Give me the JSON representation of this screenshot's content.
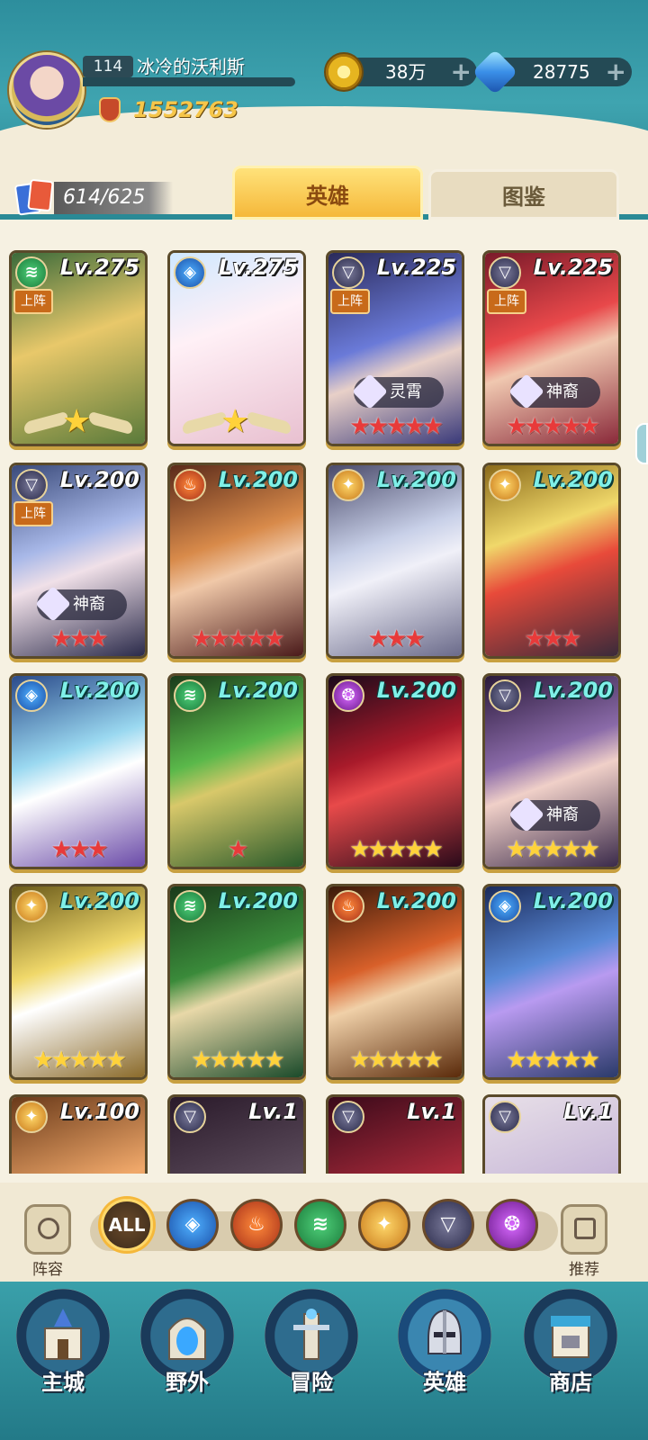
{
  "player": {
    "level": "114",
    "name": "冰冷的沃利斯",
    "power": "1552763"
  },
  "resources": {
    "gold": "38万",
    "gems": "28775"
  },
  "collection": {
    "count": "614/625"
  },
  "tabs": {
    "heroes": "英雄",
    "codex": "图鉴"
  },
  "heroes": [
    {
      "lv": "Lv.275",
      "faction": "green-faction-icon",
      "deploy": "上阵",
      "stars": "",
      "wings": true,
      "tag": ""
    },
    {
      "lv": "Lv.275",
      "faction": "blue-faction-icon",
      "deploy": "",
      "stars": "",
      "wings": true,
      "tag": ""
    },
    {
      "lv": "Lv.225",
      "faction": "dark-faction-icon",
      "deploy": "上阵",
      "stars": "★★★★★",
      "tag": "灵霄"
    },
    {
      "lv": "Lv.225",
      "faction": "dark-faction-icon",
      "deploy": "上阵",
      "stars": "★★★★★",
      "tag": "神裔"
    },
    {
      "lv": "Lv.200",
      "faction": "dark-faction-icon",
      "deploy": "上阵",
      "stars": "★★★",
      "tag": "神裔"
    },
    {
      "lv": "Lv.200",
      "faction": "fire-faction-icon",
      "deploy": "",
      "stars": "★★★★★",
      "tag": ""
    },
    {
      "lv": "Lv.200",
      "faction": "light-faction-icon",
      "deploy": "",
      "stars": "★★★",
      "tag": ""
    },
    {
      "lv": "Lv.200",
      "faction": "light-faction-icon",
      "deploy": "",
      "stars": "★★★",
      "tag": ""
    },
    {
      "lv": "Lv.200",
      "faction": "blue-faction-icon",
      "deploy": "",
      "stars": "★★★",
      "tag": ""
    },
    {
      "lv": "Lv.200",
      "faction": "green-faction-icon",
      "deploy": "",
      "stars": "★",
      "tag": ""
    },
    {
      "lv": "Lv.200",
      "faction": "purple-faction-icon",
      "deploy": "",
      "stars": "★★★★★",
      "tag": ""
    },
    {
      "lv": "Lv.200",
      "faction": "dark-faction-icon",
      "deploy": "",
      "stars": "★★★★★",
      "tag": "神裔"
    },
    {
      "lv": "Lv.200",
      "faction": "light-faction-icon",
      "deploy": "",
      "stars": "★★★★★",
      "tag": ""
    },
    {
      "lv": "Lv.200",
      "faction": "green-faction-icon",
      "deploy": "",
      "stars": "★★★★★",
      "tag": ""
    },
    {
      "lv": "Lv.200",
      "faction": "fire-faction-icon",
      "deploy": "",
      "stars": "★★★★★",
      "tag": ""
    },
    {
      "lv": "Lv.200",
      "faction": "blue-faction-icon",
      "deploy": "",
      "stars": "★★★★★",
      "tag": ""
    },
    {
      "lv": "Lv.100",
      "faction": "light-faction-icon",
      "deploy": "",
      "stars": "",
      "tag": ""
    },
    {
      "lv": "Lv.1",
      "faction": "dark-faction-icon",
      "deploy": "",
      "stars": "",
      "tag": ""
    },
    {
      "lv": "Lv.1",
      "faction": "dark-faction-icon",
      "deploy": "",
      "stars": "",
      "tag": ""
    },
    {
      "lv": "Lv.1",
      "faction": "dark-faction-icon",
      "deploy": "",
      "stars": "",
      "tag": ""
    }
  ],
  "filters": {
    "all": "ALL",
    "lineup": "阵容",
    "recommend": "推荐"
  },
  "nav": {
    "city": "主城",
    "wild": "野外",
    "adventure": "冒险",
    "heroes": "英雄",
    "shop": "商店"
  }
}
